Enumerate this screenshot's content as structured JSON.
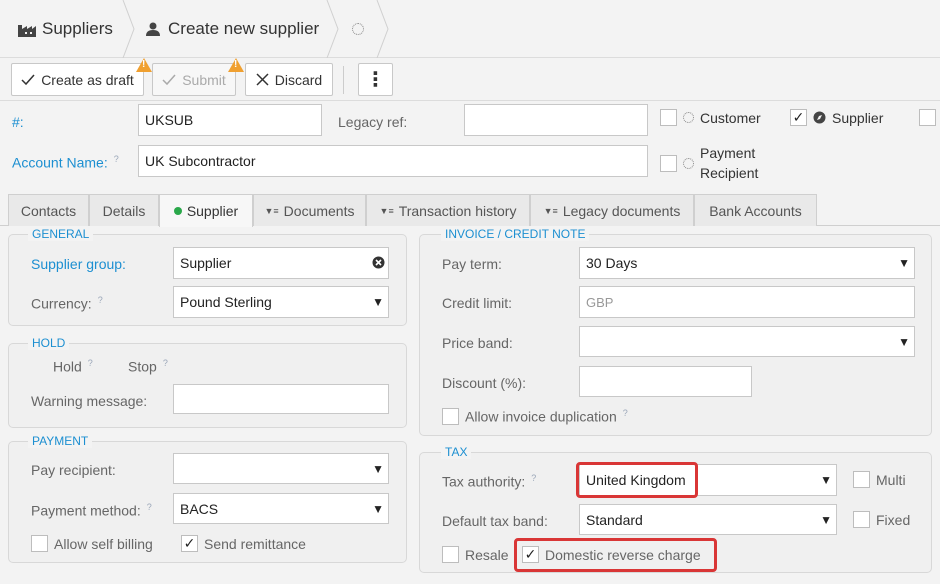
{
  "breadcrumb": {
    "item1": "Suppliers",
    "item2": "Create new supplier"
  },
  "toolbar": {
    "draft": "Create as draft",
    "submit": "Submit",
    "discard": "Discard",
    "more": "⋮"
  },
  "header": {
    "number_label": "#:",
    "number_value": "UKSUB",
    "legacy_label": "Legacy ref:",
    "legacy_value": "",
    "account_label": "Account Name:",
    "account_value": "UK Subcontractor",
    "help": "?",
    "customer": "Customer",
    "supplier": "Supplier",
    "payment_line1": "Payment",
    "payment_line2": "Recipient"
  },
  "tabs": [
    "Contacts",
    "Details",
    "Supplier",
    "Documents",
    "Transaction history",
    "Legacy documents",
    "Bank Accounts"
  ],
  "general": {
    "title": "GENERAL",
    "group_label": "Supplier group:",
    "group_value": "Supplier",
    "currency_label": "Currency:",
    "currency_value": "Pound Sterling"
  },
  "hold": {
    "title": "HOLD",
    "hold": "Hold",
    "stop": "Stop",
    "warning_label": "Warning message:",
    "warning_value": ""
  },
  "payment": {
    "title": "PAYMENT",
    "recipient_label": "Pay recipient:",
    "recipient_value": "",
    "method_label": "Payment method:",
    "method_value": "BACS",
    "self_billing": "Allow self billing",
    "remittance": "Send remittance"
  },
  "invoice": {
    "title": "INVOICE / CREDIT NOTE",
    "payterm_label": "Pay term:",
    "payterm_value": "30 Days",
    "credit_label": "Credit limit:",
    "credit_value": "GBP",
    "price_label": "Price band:",
    "price_value": "",
    "discount_label": "Discount (%):",
    "discount_value": "",
    "duplication": "Allow invoice duplication"
  },
  "tax": {
    "title": "TAX",
    "authority_label": "Tax authority:",
    "authority_value": "United Kingdom",
    "multi": "Multi",
    "band_label": "Default tax band:",
    "band_value": "Standard",
    "fixed": "Fixed",
    "resale": "Resale",
    "reverse": "Domestic reverse charge"
  },
  "colors": {
    "accent": "#1c8fd1",
    "warning": "#f0a030",
    "highlight": "#d93636",
    "status_green": "#2aa84a"
  }
}
